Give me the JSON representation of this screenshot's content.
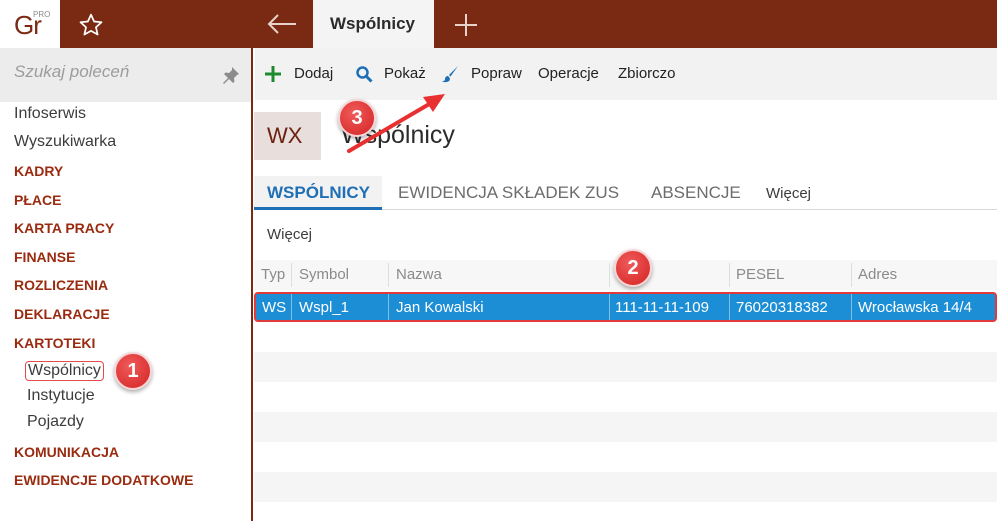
{
  "topbar": {
    "logo_main": "Gr",
    "logo_pro": "PRO",
    "active_tab": "Wspólnicy"
  },
  "sidebar": {
    "search_placeholder": "Szukaj poleceń",
    "items": [
      {
        "label": "Infoserwis",
        "kind": "plain"
      },
      {
        "label": "Wyszukiwarka",
        "kind": "plain"
      },
      {
        "label": "KADRY",
        "kind": "section"
      },
      {
        "label": "PŁACE",
        "kind": "section"
      },
      {
        "label": "KARTA PRACY",
        "kind": "section"
      },
      {
        "label": "FINANSE",
        "kind": "section"
      },
      {
        "label": "ROZLICZENIA",
        "kind": "section"
      },
      {
        "label": "DEKLARACJE",
        "kind": "section"
      },
      {
        "label": "KARTOTEKI",
        "kind": "section"
      },
      {
        "label": "Wspólnicy",
        "kind": "sub",
        "selected": true
      },
      {
        "label": "Instytucje",
        "kind": "sub"
      },
      {
        "label": "Pojazdy",
        "kind": "sub"
      },
      {
        "label": "KOMUNIKACJA",
        "kind": "section"
      },
      {
        "label": "EWIDENCJE DODATKOWE",
        "kind": "section"
      }
    ]
  },
  "toolbar": {
    "add_label": "Dodaj",
    "show_label": "Pokaż",
    "edit_label": "Popraw",
    "operations_label": "Operacje",
    "bulk_label": "Zbiorczo"
  },
  "header": {
    "badge": "WX",
    "title": "Wspólnicy"
  },
  "tabs": {
    "items": [
      "WSPÓLNICY",
      "EWIDENCJA SKŁADEK ZUS",
      "ABSENCJE"
    ],
    "more_label": "Więcej"
  },
  "subbar": {
    "more_label": "Więcej"
  },
  "table": {
    "columns": [
      "Typ",
      "Symbol",
      "Nazwa",
      "PESEL",
      "Adres"
    ],
    "rows": [
      {
        "typ": "WS",
        "symbol": "Wspl_1",
        "nazwa": "Jan Kowalski",
        "nip": "111-11-11-109",
        "pesel": "76020318382",
        "adres": "Wrocławska 14/4"
      }
    ]
  },
  "annotations": {
    "marker1": "1",
    "marker2": "2",
    "marker3": "3"
  },
  "colors": {
    "brand": "#7a2a12",
    "accent_blue": "#1e6fb5",
    "selected_row": "#1c8ed6",
    "marker_red": "#d42323"
  }
}
